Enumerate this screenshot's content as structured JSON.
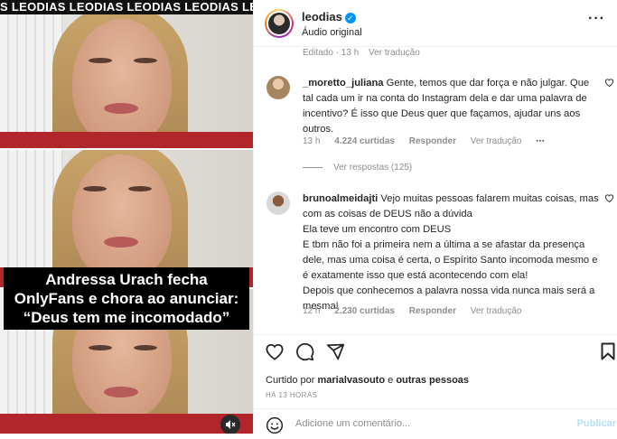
{
  "video": {
    "ticker": "S LEODIAS LEODIAS LEODIAS LEODIAS LEODIAS LEO",
    "caption": "Andressa Urach fecha OnlyFans e chora ao anunciar: “Deus tem me incomodado”"
  },
  "post": {
    "username": "leodias",
    "audio": "Áudio original",
    "edited": "Editado · 13 h",
    "translate": "Ver tradução"
  },
  "comments": [
    {
      "username": "_moretto_juliana",
      "text": "Gente, temos que dar força e não julgar. Que tal cada um ir na conta do Instagram dela e dar uma palavra de incentivo? É isso que Deus quer que façamos, ajudar uns aos outros.",
      "time": "13 h",
      "likes": "4.224 curtidas",
      "reply": "Responder",
      "translate": "Ver tradução",
      "replies": "Ver respostas (125)"
    },
    {
      "username": "brunoalmeidajti",
      "text": "Vejo muitas pessoas falarem muitas coisas, mas com as coisas de DEUS não a dúvida",
      "lines": [
        "Ela teve um encontro com DEUS",
        "E tbm não foi a primeira nem a última a se afastar da presença dele, mas uma coisa é certa, o Espírito Santo incomoda mesmo e é exatamente isso que está acontecendo com ela!",
        "Depois que conhecemos a palavra nossa vida nunca mais será a mesma!"
      ],
      "time": "12 h",
      "likes": "2.230 curtidas",
      "reply": "Responder",
      "translate": "Ver tradução"
    }
  ],
  "footer": {
    "liked_prefix": "Curtido por",
    "liked_user": "marialvasouto",
    "liked_mid": "e",
    "liked_rest": "outras pessoas",
    "when": "HÁ 13 HORAS",
    "comment_placeholder": "Adicione um comentário...",
    "publish": "Publicar"
  },
  "icons": [
    "heart-icon",
    "comment-icon",
    "share-icon",
    "bookmark-icon",
    "emoji-icon",
    "mute-icon",
    "verified-icon",
    "more-icon"
  ],
  "colors": {
    "accent": "#0095f6",
    "muted": "#8e8e8e",
    "publish_disabled": "#b2dffc"
  }
}
